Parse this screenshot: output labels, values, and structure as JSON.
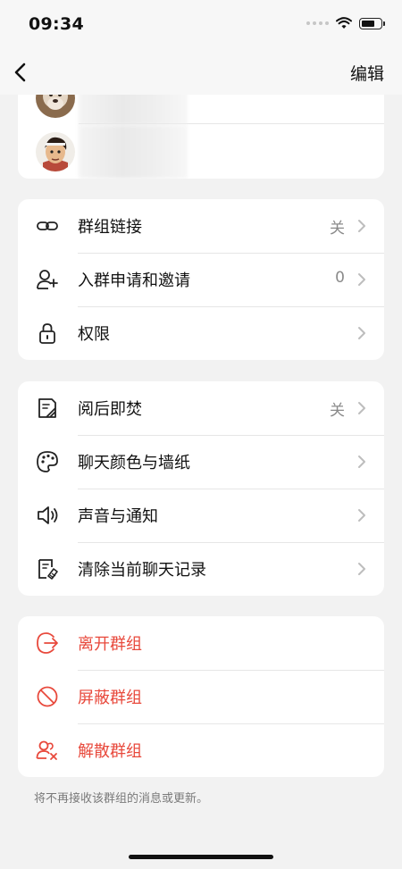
{
  "status_bar": {
    "time": "09:34"
  },
  "nav": {
    "edit_label": "编辑"
  },
  "permissions_section": {
    "items": [
      {
        "label": "群组链接",
        "value": "关",
        "icon": "link-icon"
      },
      {
        "label": "入群申请和邀请",
        "value": "0",
        "icon": "add-user-icon"
      },
      {
        "label": "权限",
        "value": "",
        "icon": "lock-icon"
      }
    ]
  },
  "chat_section": {
    "items": [
      {
        "label": "阅后即焚",
        "value": "关",
        "icon": "burn-after-reading-icon"
      },
      {
        "label": "聊天颜色与墙纸",
        "value": "",
        "icon": "palette-icon"
      },
      {
        "label": "声音与通知",
        "value": "",
        "icon": "speaker-icon"
      },
      {
        "label": "清除当前聊天记录",
        "value": "",
        "icon": "clear-history-icon"
      }
    ]
  },
  "danger_section": {
    "items": [
      {
        "label": "离开群组",
        "icon": "leave-icon"
      },
      {
        "label": "屏蔽群组",
        "icon": "block-icon"
      },
      {
        "label": "解散群组",
        "icon": "disband-icon"
      }
    ]
  },
  "footnote": "将不再接收该群组的消息或更新。",
  "colors": {
    "danger": "#e8493c",
    "secondary_text": "#8a8a8a",
    "background": "#f2f2f2"
  }
}
